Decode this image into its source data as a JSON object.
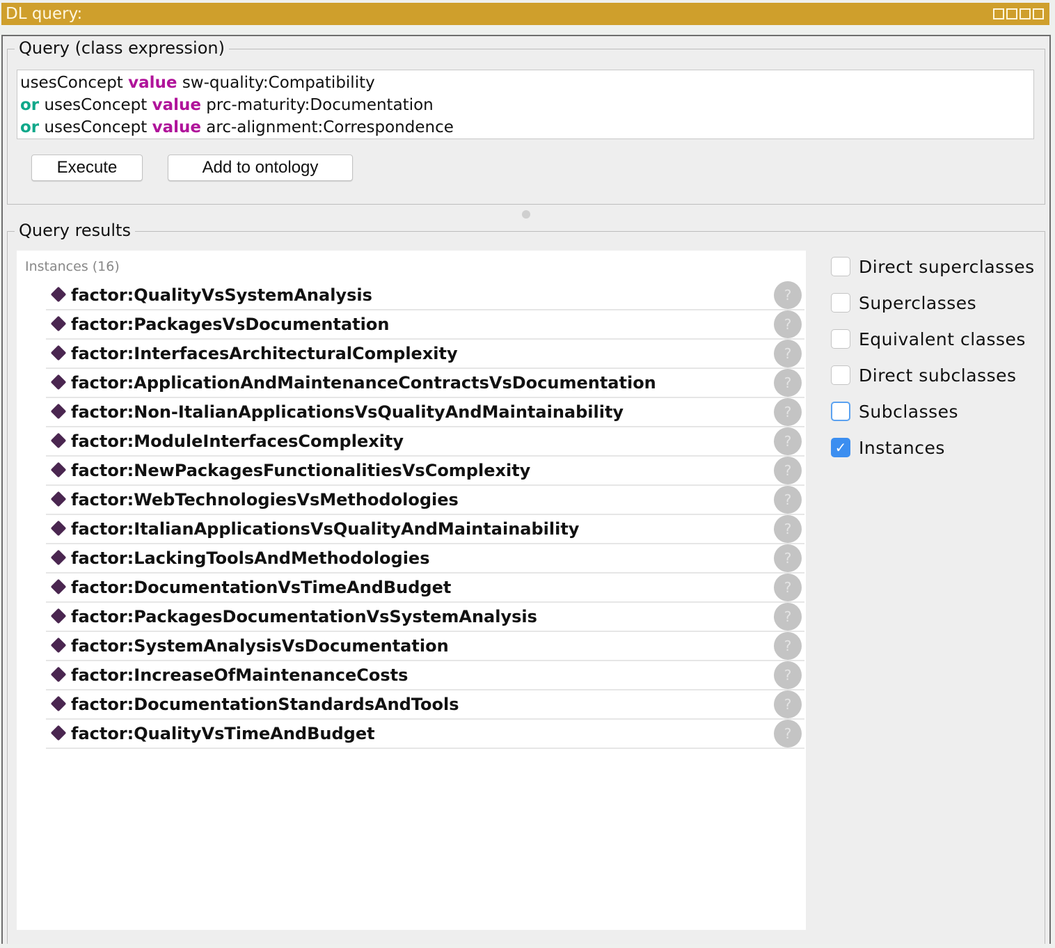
{
  "window": {
    "title": "DL query:"
  },
  "query": {
    "legend": "Query (class expression)",
    "lines": [
      {
        "prefix": "",
        "prop": "usesConcept ",
        "kw": "value",
        "value": " sw-quality:Compatibility"
      },
      {
        "prefix": "or",
        "prop": " usesConcept ",
        "kw": "value",
        "value": " prc-maturity:Documentation"
      },
      {
        "prefix": "or",
        "prop": " usesConcept ",
        "kw": "value",
        "value": " arc-alignment:Correspondence"
      }
    ],
    "execute_label": "Execute",
    "add_label": "Add to ontology"
  },
  "results": {
    "legend": "Query results",
    "title": "Instances (16)",
    "help_glyph": "?",
    "items": [
      "factor:QualityVsSystemAnalysis",
      "factor:PackagesVsDocumentation",
      "factor:InterfacesArchitecturalComplexity",
      "factor:ApplicationAndMaintenanceContractsVsDocumentation",
      "factor:Non-ItalianApplicationsVsQualityAndMaintainability",
      "factor:ModuleInterfacesComplexity",
      "factor:NewPackagesFunctionalitiesVsComplexity",
      "factor:WebTechnologiesVsMethodologies",
      "factor:ItalianApplicationsVsQualityAndMaintainability",
      "factor:LackingToolsAndMethodologies",
      "factor:DocumentationVsTimeAndBudget",
      "factor:PackagesDocumentationVsSystemAnalysis",
      "factor:SystemAnalysisVsDocumentation",
      "factor:IncreaseOfMaintenanceCosts",
      "factor:DocumentationStandardsAndTools",
      "factor:QualityVsTimeAndBudget"
    ]
  },
  "options": [
    {
      "label": "Direct superclasses",
      "checked": false
    },
    {
      "label": "Superclasses",
      "checked": false
    },
    {
      "label": "Equivalent classes",
      "checked": false
    },
    {
      "label": "Direct subclasses",
      "checked": false
    },
    {
      "label": "Subclasses",
      "checked": false,
      "focused": true
    },
    {
      "label": "Instances",
      "checked": true
    }
  ]
}
